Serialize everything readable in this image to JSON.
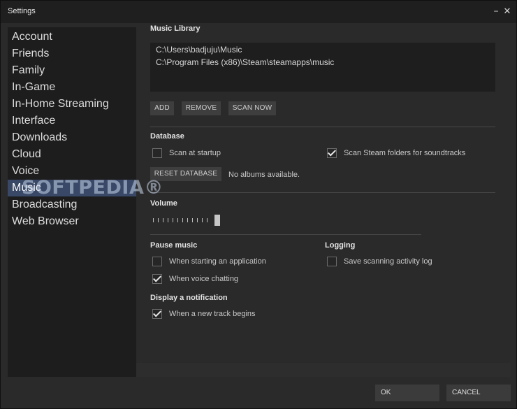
{
  "window": {
    "title": "Settings",
    "minimize_glyph": "−",
    "close_glyph": "✕"
  },
  "sidebar": {
    "items": [
      {
        "label": "Account"
      },
      {
        "label": "Friends"
      },
      {
        "label": "Family"
      },
      {
        "label": "In-Game"
      },
      {
        "label": "In-Home Streaming"
      },
      {
        "label": "Interface"
      },
      {
        "label": "Downloads"
      },
      {
        "label": "Cloud"
      },
      {
        "label": "Voice"
      },
      {
        "label": "Music",
        "active": true
      },
      {
        "label": "Broadcasting"
      },
      {
        "label": "Web Browser"
      }
    ]
  },
  "watermark": {
    "text": "SOFTPEDIA®"
  },
  "music_library": {
    "title": "Music Library",
    "paths": [
      "C:\\Users\\badjuju\\Music",
      "C:\\Program Files (x86)\\Steam\\steamapps\\music"
    ],
    "buttons": {
      "add": "ADD",
      "remove": "REMOVE",
      "scan_now": "SCAN NOW"
    }
  },
  "database": {
    "title": "Database",
    "scan_at_startup": {
      "label": "Scan at startup",
      "checked": false
    },
    "scan_steam_folders": {
      "label": "Scan Steam folders for soundtracks",
      "checked": true
    },
    "reset_button": "RESET DATABASE",
    "status": "No albums available."
  },
  "volume": {
    "title": "Volume",
    "level": 1.0,
    "ticks": 12
  },
  "pause_music": {
    "title": "Pause music",
    "starting_app": {
      "label": "When starting an application",
      "checked": false
    },
    "voice_chatting": {
      "label": "When voice chatting",
      "checked": true
    }
  },
  "logging": {
    "title": "Logging",
    "save_scanning_log": {
      "label": "Save scanning activity log",
      "checked": false
    }
  },
  "notification": {
    "title": "Display a notification",
    "new_track": {
      "label": "When a new track begins",
      "checked": true
    }
  },
  "footer": {
    "ok": "OK",
    "cancel": "CANCEL"
  }
}
